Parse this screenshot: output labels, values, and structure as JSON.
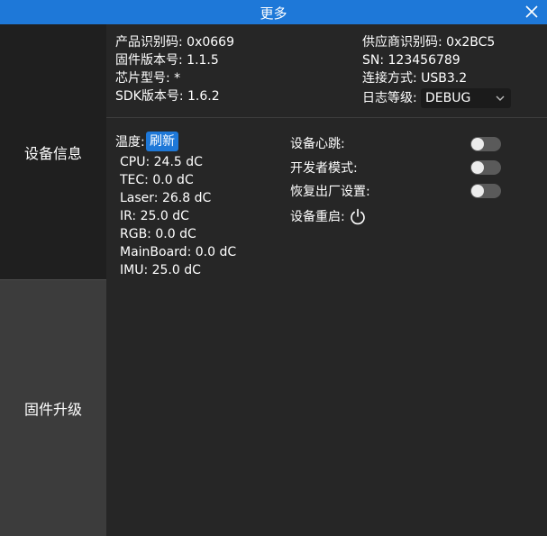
{
  "window": {
    "title": "更多"
  },
  "sidebar": {
    "items": [
      {
        "label": "设备信息",
        "active": true
      },
      {
        "label": "固件升级",
        "active": false
      }
    ]
  },
  "device_info": {
    "product_id": "产品识别码: 0x0669",
    "firmware_version": "固件版本号: 1.1.5",
    "chip_model": "芯片型号: *",
    "sdk_version": "SDK版本号: 1.6.2",
    "vendor_id": "供应商识别码: 0x2BC5",
    "sn": "SN: 123456789",
    "connection": "连接方式: USB3.2",
    "log_level_label": "日志等级:",
    "log_level_value": "DEBUG"
  },
  "temperature": {
    "label": "温度:",
    "refresh_label": "刷新",
    "readings": [
      "CPU: 24.5 dC",
      "TEC: 0.0 dC",
      "Laser: 26.8 dC",
      "IR: 25.0 dC",
      "RGB: 0.0 dC",
      "MainBoard: 0.0 dC",
      "IMU: 25.0 dC"
    ]
  },
  "settings": {
    "heartbeat_label": "设备心跳:",
    "heartbeat_on": false,
    "dev_mode_label": "开发者模式:",
    "dev_mode_on": false,
    "factory_reset_label": "恢复出厂设置:",
    "factory_reset_on": false,
    "reboot_label": "设备重启:"
  },
  "colors": {
    "accent": "#1e78d8",
    "background": "#262626",
    "sidebar_active": "#1f1f1f",
    "sidebar_inactive": "#3c3c3c",
    "toggle_off": "#5a5a5a"
  },
  "icons": {
    "close": "close-icon",
    "dropdown": "chevron-down-icon",
    "reboot": "power-icon"
  }
}
